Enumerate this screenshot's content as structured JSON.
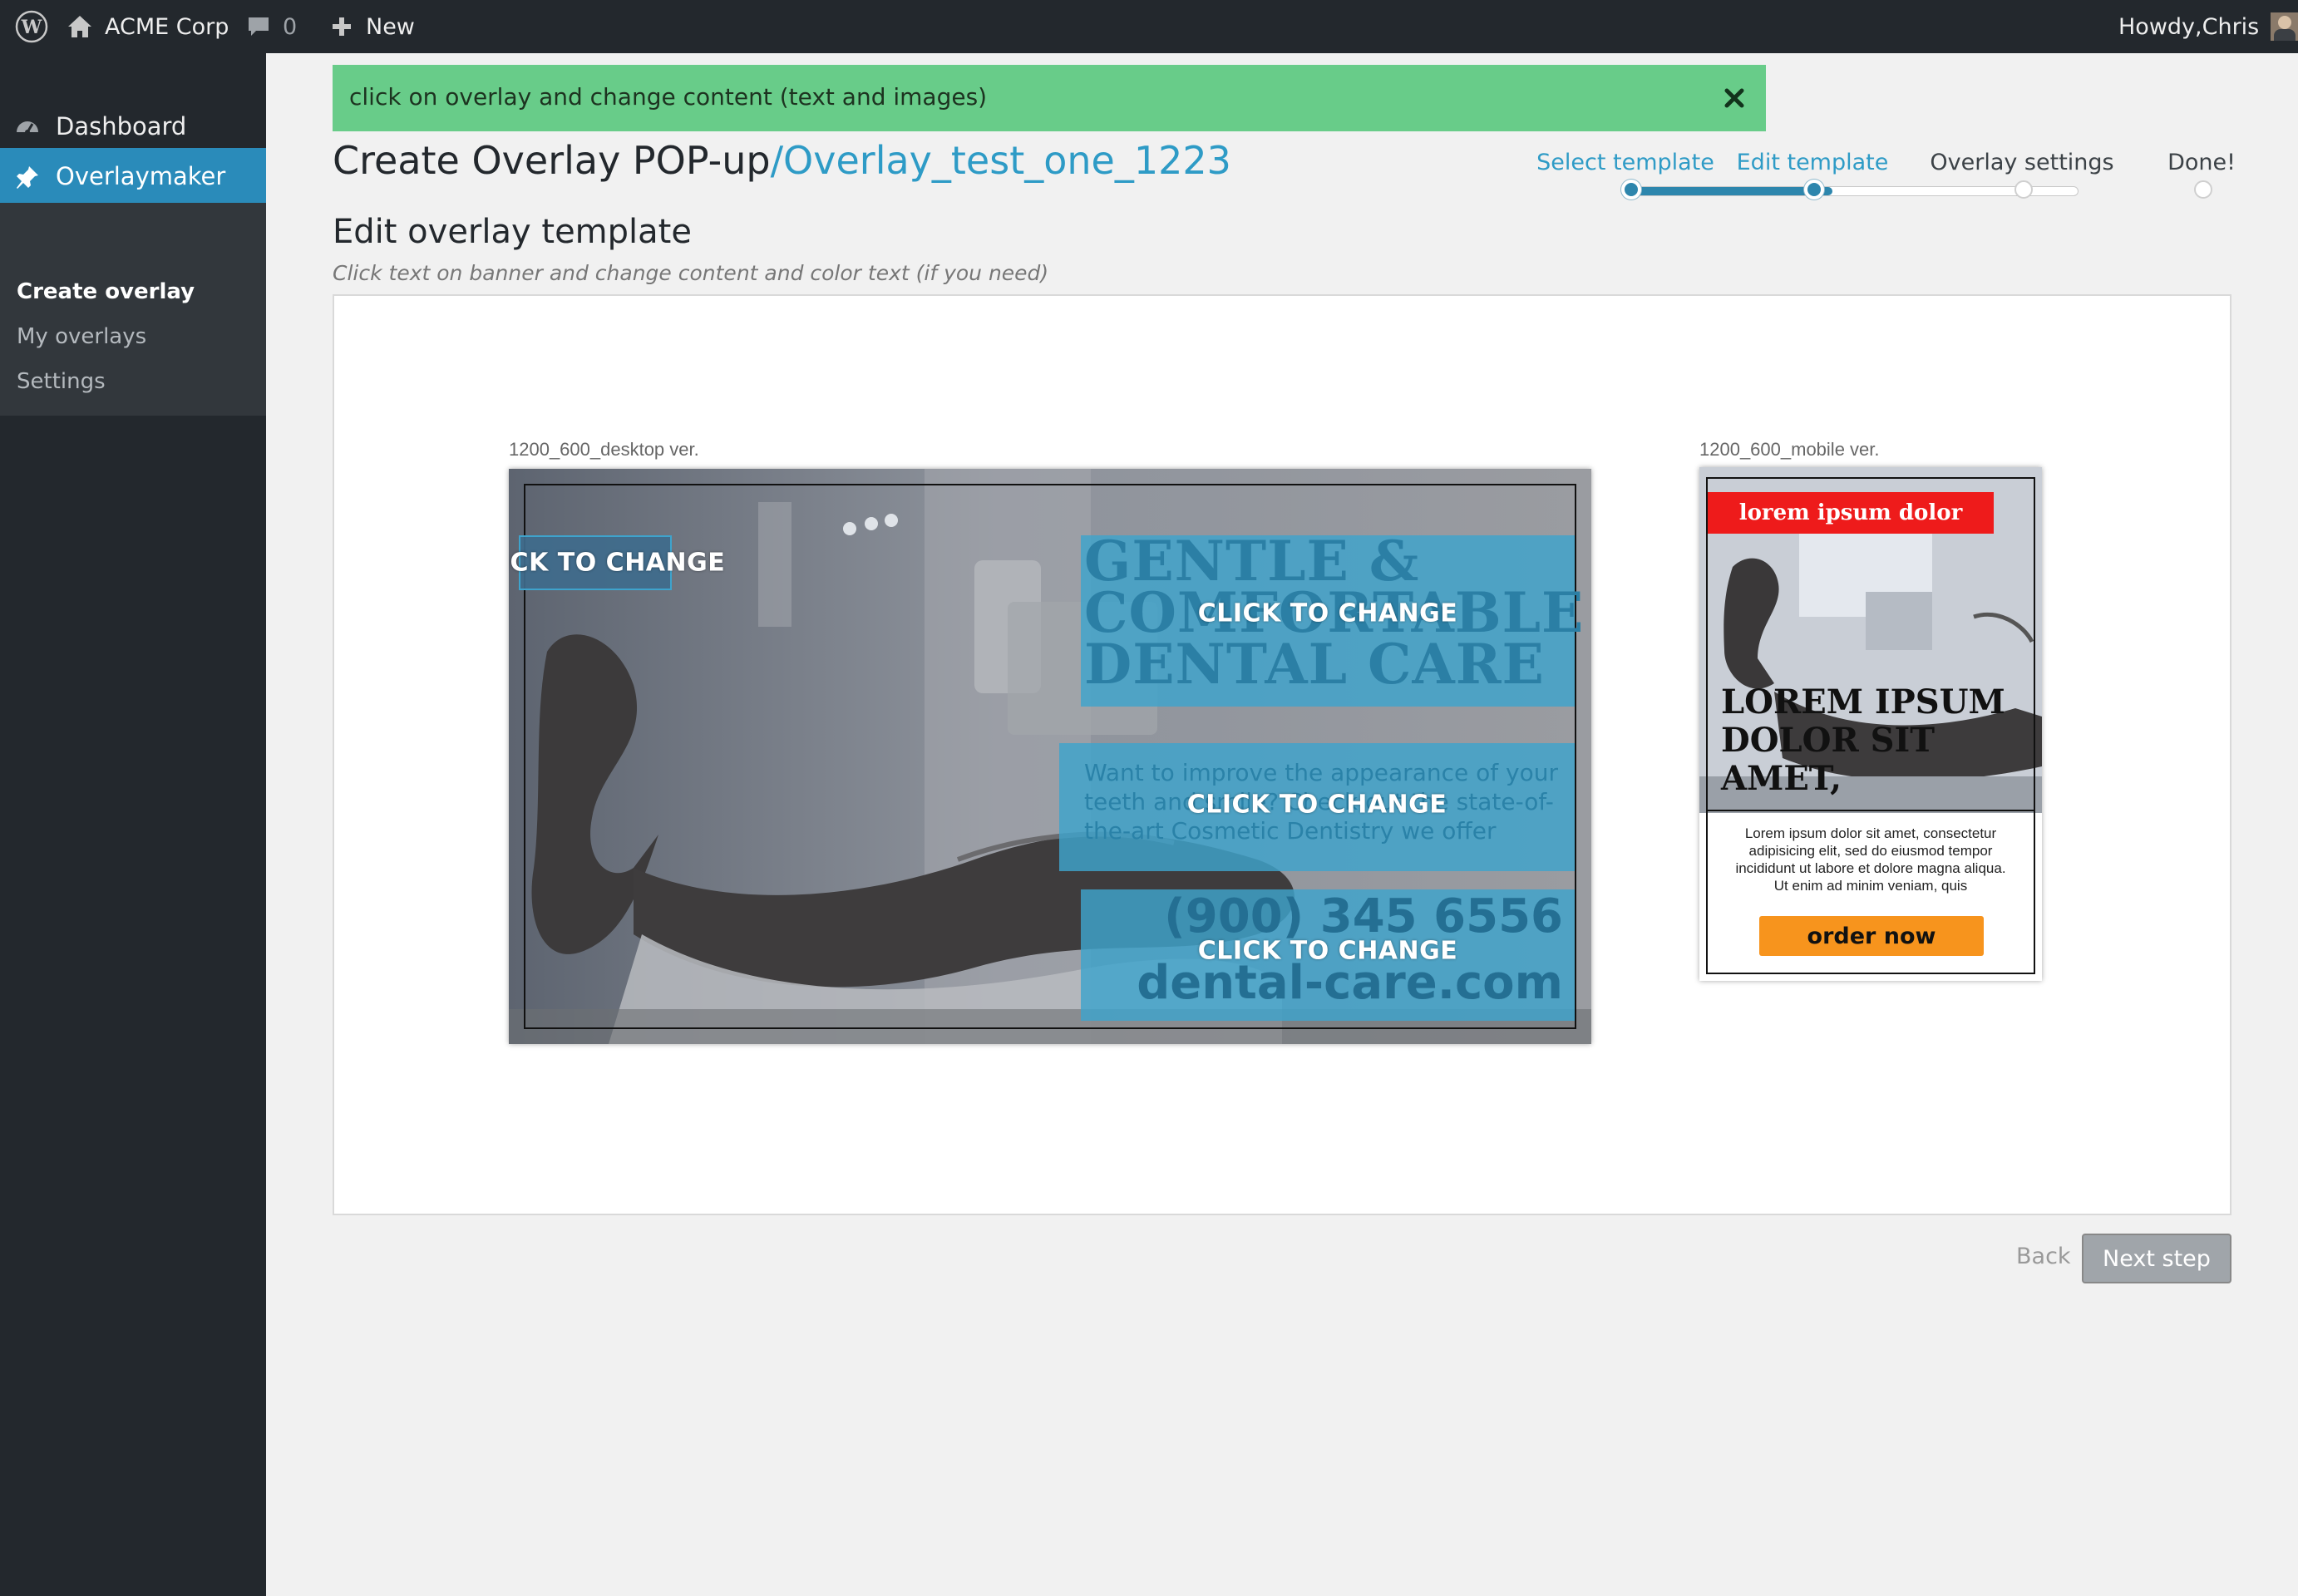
{
  "admin_bar": {
    "site_name": "ACME Corp",
    "comments_count": "0",
    "new_label": "New",
    "greeting": "Howdy,Chris"
  },
  "sidebar": {
    "dashboard_label": "Dashboard",
    "plugin_label": "Overlaymaker",
    "submenu": [
      {
        "label": "Create overlay",
        "active": true
      },
      {
        "label": "My overlays",
        "active": false
      },
      {
        "label": "Settings",
        "active": false
      }
    ]
  },
  "notice": {
    "text": "click on overlay and change content (text and images)"
  },
  "page": {
    "title": "Create Overlay POP-up",
    "subtitle": "/Overlay_test_one_1223"
  },
  "steps": [
    {
      "label": "Select template",
      "done": true
    },
    {
      "label": "Edit template",
      "done": true
    },
    {
      "label": "Overlay settings",
      "done": false
    },
    {
      "label": "Done!",
      "done": false
    }
  ],
  "editor": {
    "section_title": "Edit overlay template",
    "hint": "Click text on banner and change content and color text (if you need)"
  },
  "desktop": {
    "label": "1200_600_desktop ver.",
    "click_label": "CLICK TO CHANGE",
    "headline": "GENTLE &\nCOMFORTABLE\nDENTAL CARE",
    "body": "Want to improve the appearance of your teeth and smile? Check out the state-of-the-art Cosmetic Dentistry we offer",
    "phone": "(900) 345 6556",
    "website": "dental-care.com"
  },
  "mobile": {
    "label": "1200_600_mobile ver.",
    "tag": "lorem ipsum dolor",
    "headline": "LOREM IPSUM\nDOLOR SIT\nAMET,",
    "body": "Lorem ipsum dolor sit amet, consectetur adipisicing elit, sed do eiusmod tempor incididunt ut labore et dolore magna aliqua. Ut enim ad minim veniam, quis",
    "cta": "order now"
  },
  "footer": {
    "back_label": "Back",
    "next_label": "Next step"
  },
  "colors": {
    "sidebar_bg": "#23282d",
    "active_menu": "#2a8bba",
    "notice_bg": "#68cc89",
    "link_blue": "#2e9bc6",
    "mobile_tag": "#ee1b1b",
    "cta_orange": "#f7941d"
  }
}
